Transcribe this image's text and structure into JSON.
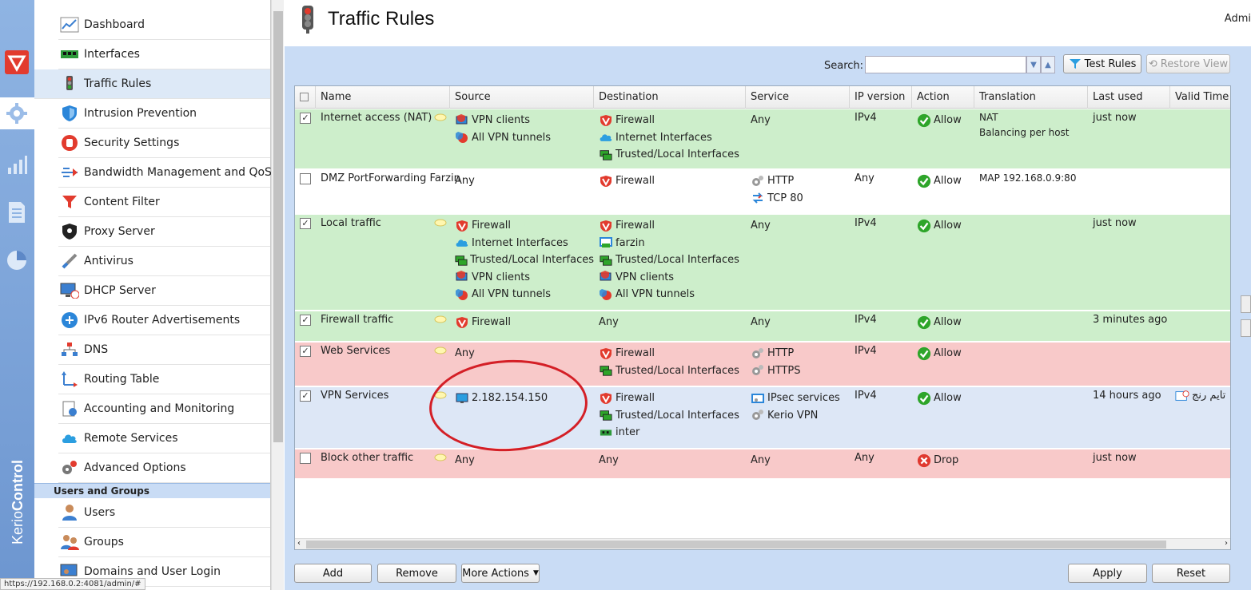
{
  "header": {
    "title": "Traffic Rules",
    "user_label": "Admi"
  },
  "nav": {
    "items": [
      {
        "label": "Dashboard",
        "icon": "dashboard-icon"
      },
      {
        "label": "Interfaces",
        "icon": "interfaces-icon"
      },
      {
        "label": "Traffic Rules",
        "icon": "traffic-light-icon",
        "active": true
      },
      {
        "label": "Intrusion Prevention",
        "icon": "shield-icon"
      },
      {
        "label": "Security Settings",
        "icon": "hand-stop-icon"
      },
      {
        "label": "Bandwidth Management and QoS",
        "icon": "bandwidth-icon"
      },
      {
        "label": "Content Filter",
        "icon": "funnel-icon"
      },
      {
        "label": "Proxy Server",
        "icon": "proxy-icon"
      },
      {
        "label": "Antivirus",
        "icon": "syringe-icon"
      },
      {
        "label": "DHCP Server",
        "icon": "dhcp-icon"
      },
      {
        "label": "IPv6 Router Advertisements",
        "icon": "ipv6-icon"
      },
      {
        "label": "DNS",
        "icon": "dns-icon"
      },
      {
        "label": "Routing Table",
        "icon": "routing-icon"
      },
      {
        "label": "Accounting and Monitoring",
        "icon": "accounting-icon"
      },
      {
        "label": "Remote Services",
        "icon": "cloud-icon"
      },
      {
        "label": "Advanced Options",
        "icon": "gears-icon"
      }
    ],
    "section_users": "Users and Groups",
    "user_items": [
      {
        "label": "Users",
        "icon": "user-icon"
      },
      {
        "label": "Groups",
        "icon": "group-icon"
      },
      {
        "label": "Domains and User Login",
        "icon": "domain-icon"
      }
    ]
  },
  "brand": {
    "text_light": "Kerio",
    "text_bold": "Control"
  },
  "statusbar": {
    "url": "https://192.168.0.2:4081/admin/#"
  },
  "toolbar": {
    "search_label": "Search:",
    "test_rules": "Test Rules",
    "restore_view": "Restore View"
  },
  "grid": {
    "columns": [
      "Name",
      "Source",
      "Destination",
      "Service",
      "IP version",
      "Action",
      "Translation",
      "Last used",
      "Valid Time"
    ],
    "rows": [
      {
        "checked": true,
        "color": "#cdeecb",
        "name": "Internet access (NAT)",
        "source": [
          {
            "i": "vpn-clients-icon",
            "t": "VPN clients"
          },
          {
            "i": "vpn-tunnel-icon",
            "t": "All VPN tunnels"
          }
        ],
        "destination": [
          {
            "i": "firewall-icon",
            "t": "Firewall"
          },
          {
            "i": "cloud-icon",
            "t": "Internet Interfaces"
          },
          {
            "i": "lan-icon",
            "t": "Trusted/Local Interfaces"
          }
        ],
        "service": [
          {
            "i": "",
            "t": "Any"
          }
        ],
        "ipver": "IPv4",
        "action": "Allow",
        "translation": [
          "NAT",
          "Balancing per host"
        ],
        "last_used": "just now",
        "valid": ""
      },
      {
        "checked": false,
        "color": "#ffffff",
        "name": "DMZ PortForwarding Farzin",
        "source": [
          {
            "i": "",
            "t": "Any"
          }
        ],
        "destination": [
          {
            "i": "firewall-icon",
            "t": "Firewall"
          }
        ],
        "service": [
          {
            "i": "service-icon",
            "t": "HTTP"
          },
          {
            "i": "port-icon",
            "t": "TCP 80"
          }
        ],
        "ipver": "Any",
        "action": "Allow",
        "translation": [
          "MAP 192.168.0.9:80"
        ],
        "last_used": "",
        "valid": ""
      },
      {
        "checked": true,
        "color": "#cdeecb",
        "name": "Local traffic",
        "source": [
          {
            "i": "firewall-icon",
            "t": "Firewall"
          },
          {
            "i": "cloud-icon",
            "t": "Internet Interfaces"
          },
          {
            "i": "lan-icon",
            "t": "Trusted/Local Interfaces"
          },
          {
            "i": "vpn-clients-icon",
            "t": "VPN clients"
          },
          {
            "i": "vpn-tunnel-icon",
            "t": "All VPN tunnels"
          }
        ],
        "destination": [
          {
            "i": "firewall-icon",
            "t": "Firewall"
          },
          {
            "i": "interface-icon",
            "t": "farzin"
          },
          {
            "i": "lan-icon",
            "t": "Trusted/Local Interfaces"
          },
          {
            "i": "vpn-clients-icon",
            "t": "VPN clients"
          },
          {
            "i": "vpn-tunnel-icon",
            "t": "All VPN tunnels"
          }
        ],
        "service": [
          {
            "i": "",
            "t": "Any"
          }
        ],
        "ipver": "IPv4",
        "action": "Allow",
        "translation": [],
        "last_used": "just now",
        "valid": ""
      },
      {
        "checked": true,
        "color": "#cdeecb",
        "name": "Firewall traffic",
        "source": [
          {
            "i": "firewall-icon",
            "t": "Firewall"
          }
        ],
        "destination": [
          {
            "i": "",
            "t": "Any"
          }
        ],
        "service": [
          {
            "i": "",
            "t": "Any"
          }
        ],
        "ipver": "IPv4",
        "action": "Allow",
        "translation": [],
        "last_used": "3 minutes ago",
        "valid": ""
      },
      {
        "checked": true,
        "color": "#f8c9c9",
        "name": "Web Services",
        "source": [
          {
            "i": "",
            "t": "Any"
          }
        ],
        "destination": [
          {
            "i": "firewall-icon",
            "t": "Firewall"
          },
          {
            "i": "lan-icon",
            "t": "Trusted/Local Interfaces"
          }
        ],
        "service": [
          {
            "i": "service-icon",
            "t": "HTTP"
          },
          {
            "i": "service-icon",
            "t": "HTTPS"
          }
        ],
        "ipver": "IPv4",
        "action": "Allow",
        "translation": [],
        "last_used": "",
        "valid": ""
      },
      {
        "checked": true,
        "color": "#dde7f6",
        "name": "VPN Services",
        "source": [
          {
            "i": "host-icon",
            "t": "2.182.154.150"
          }
        ],
        "destination": [
          {
            "i": "firewall-icon",
            "t": "Firewall"
          },
          {
            "i": "lan-icon",
            "t": "Trusted/Local Interfaces"
          },
          {
            "i": "nic-icon",
            "t": "inter"
          }
        ],
        "service": [
          {
            "i": "ipsec-icon",
            "t": "IPsec services"
          },
          {
            "i": "service-icon",
            "t": "Kerio VPN"
          }
        ],
        "ipver": "IPv4",
        "action": "Allow",
        "translation": [],
        "last_used": "14 hours ago",
        "valid": "تايم رنج"
      },
      {
        "checked": false,
        "color": "#f8c9c9",
        "name": "Block other traffic",
        "source": [
          {
            "i": "",
            "t": "Any"
          }
        ],
        "destination": [
          {
            "i": "",
            "t": "Any"
          }
        ],
        "service": [
          {
            "i": "",
            "t": "Any"
          }
        ],
        "ipver": "Any",
        "action": "Drop",
        "translation": [],
        "last_used": "just now",
        "valid": ""
      }
    ]
  },
  "footer": {
    "add": "Add",
    "remove": "Remove",
    "more_actions": "More Actions",
    "apply": "Apply",
    "reset": "Reset"
  },
  "colors": {
    "allow": "#2ea52a",
    "drop": "#e0392f",
    "firewall": "#e23b2e"
  }
}
